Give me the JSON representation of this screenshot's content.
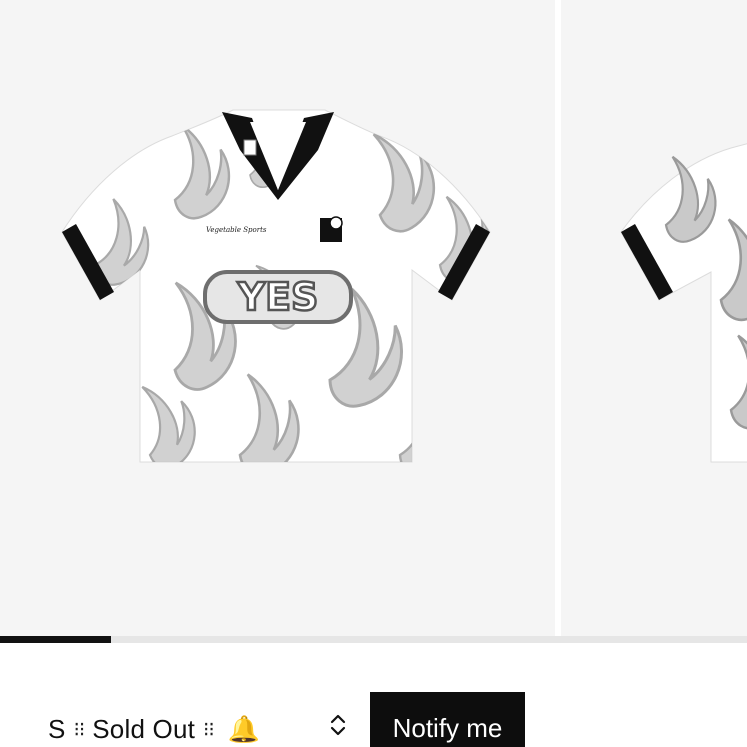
{
  "gallery": {
    "progress": 0.148,
    "colors": {
      "background": "#f5f5f5",
      "progress_fill": "#111111",
      "progress_track": "#e6e6e6"
    },
    "product_image": {
      "icon": "flame-soccer-jersey-image",
      "chest_text": "YES",
      "sponsor_text": "Vegetable Sports"
    }
  },
  "variant": {
    "size": "S",
    "separator": "⁝⁝",
    "status": "Sold Out",
    "bell": "🔔",
    "chevron": "⇕"
  },
  "notify_button": {
    "label": "Notify me",
    "background": "#0d0d0d"
  }
}
